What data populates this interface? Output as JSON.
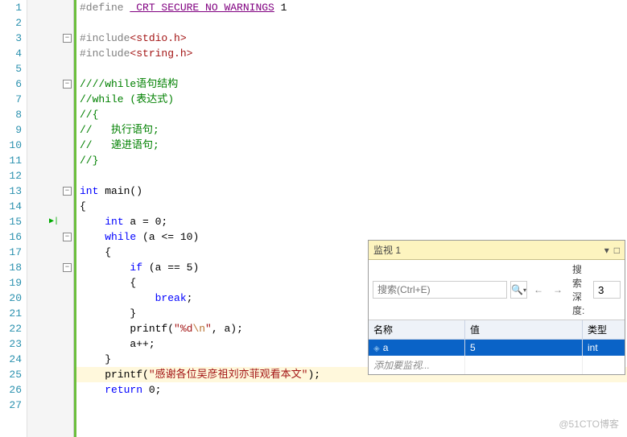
{
  "lines": [
    {
      "n": "1",
      "fold": "",
      "html": [
        [
          "kw-pp",
          "#define "
        ],
        [
          "kw-macro",
          "_CRT_SECURE_NO_WARNINGS"
        ],
        [
          "kw-txt",
          " 1"
        ]
      ]
    },
    {
      "n": "2",
      "fold": "",
      "html": []
    },
    {
      "n": "3",
      "fold": "-",
      "html": [
        [
          "kw-inc",
          "#include"
        ],
        [
          "kw-hdr",
          "<stdio.h>"
        ]
      ]
    },
    {
      "n": "4",
      "fold": "",
      "html": [
        [
          "kw-inc",
          "#include"
        ],
        [
          "kw-hdr",
          "<string.h>"
        ]
      ]
    },
    {
      "n": "5",
      "fold": "",
      "html": []
    },
    {
      "n": "6",
      "fold": "-",
      "html": [
        [
          "kw-cmt",
          "////while语句结构"
        ]
      ]
    },
    {
      "n": "7",
      "fold": "",
      "html": [
        [
          "kw-cmt",
          "//while (表达式)"
        ]
      ]
    },
    {
      "n": "8",
      "fold": "",
      "html": [
        [
          "kw-cmt",
          "//{"
        ]
      ]
    },
    {
      "n": "9",
      "fold": "",
      "html": [
        [
          "kw-cmt",
          "//   执行语句;"
        ]
      ]
    },
    {
      "n": "10",
      "fold": "",
      "html": [
        [
          "kw-cmt",
          "//   递进语句;"
        ]
      ]
    },
    {
      "n": "11",
      "fold": "",
      "html": [
        [
          "kw-cmt",
          "//}"
        ]
      ]
    },
    {
      "n": "12",
      "fold": "",
      "html": []
    },
    {
      "n": "13",
      "fold": "-",
      "html": [
        [
          "kw-blue",
          "int"
        ],
        [
          "kw-txt",
          " main()"
        ]
      ]
    },
    {
      "n": "14",
      "fold": "",
      "html": [
        [
          "kw-txt",
          "{"
        ]
      ]
    },
    {
      "n": "15",
      "fold": "",
      "play": true,
      "html": [
        [
          "kw-txt",
          "    "
        ],
        [
          "kw-blue",
          "int"
        ],
        [
          "kw-txt",
          " a = 0;"
        ]
      ]
    },
    {
      "n": "16",
      "fold": "-",
      "html": [
        [
          "kw-txt",
          "    "
        ],
        [
          "kw-blue",
          "while"
        ],
        [
          "kw-txt",
          " (a <= 10)"
        ]
      ]
    },
    {
      "n": "17",
      "fold": "",
      "html": [
        [
          "kw-txt",
          "    {"
        ]
      ]
    },
    {
      "n": "18",
      "fold": "-",
      "html": [
        [
          "kw-txt",
          "        "
        ],
        [
          "kw-blue",
          "if"
        ],
        [
          "kw-txt",
          " (a == 5)"
        ]
      ]
    },
    {
      "n": "19",
      "fold": "",
      "html": [
        [
          "kw-txt",
          "        {"
        ]
      ]
    },
    {
      "n": "20",
      "fold": "",
      "html": [
        [
          "kw-txt",
          "            "
        ],
        [
          "kw-blue",
          "break"
        ],
        [
          "kw-txt",
          ";"
        ]
      ]
    },
    {
      "n": "21",
      "fold": "",
      "html": [
        [
          "kw-txt",
          "        }"
        ]
      ]
    },
    {
      "n": "22",
      "fold": "",
      "html": [
        [
          "kw-txt",
          "        printf("
        ],
        [
          "kw-str",
          "\"%d"
        ],
        [
          "kw-esc",
          "\\n"
        ],
        [
          "kw-str",
          "\""
        ],
        [
          "kw-txt",
          ", a);"
        ]
      ]
    },
    {
      "n": "23",
      "fold": "",
      "html": [
        [
          "kw-txt",
          "        a++;"
        ]
      ]
    },
    {
      "n": "24",
      "fold": "",
      "html": [
        [
          "kw-txt",
          "    }"
        ]
      ]
    },
    {
      "n": "25",
      "fold": "",
      "exec": true,
      "html": [
        [
          "kw-txt",
          "    printf("
        ],
        [
          "kw-str",
          "\"感谢各位吴彦祖刘亦菲观看本文\""
        ],
        [
          "kw-txt",
          ");"
        ]
      ]
    },
    {
      "n": "26",
      "fold": "",
      "html": [
        [
          "kw-txt",
          "    "
        ],
        [
          "kw-blue",
          "return"
        ],
        [
          "kw-txt",
          " 0;"
        ]
      ]
    },
    {
      "n": "27",
      "fold": "",
      "html": []
    }
  ],
  "watch": {
    "title": "监视 1",
    "search_placeholder": "搜索(Ctrl+E)",
    "depth_label": "搜索深度:",
    "depth_value": "3",
    "cols": {
      "name": "名称",
      "value": "值",
      "type": "类型"
    },
    "row": {
      "name": "a",
      "value": "5",
      "type": "int"
    },
    "add_hint": "添加要监视..."
  },
  "watermark": "@51CTO博客"
}
